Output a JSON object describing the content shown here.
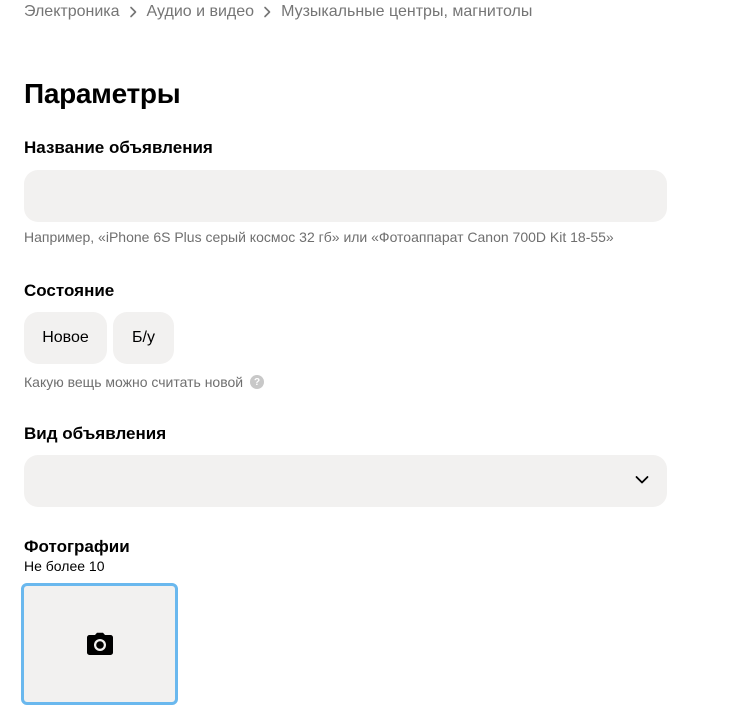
{
  "breadcrumb": {
    "items": [
      "Электроника",
      "Аудио и видео",
      "Музыкальные центры, магнитолы"
    ]
  },
  "page": {
    "title": "Параметры"
  },
  "title_field": {
    "label": "Название объявления",
    "value": "",
    "hint": "Например, «iPhone 6S Plus серый космос 32 гб» или «Фотоаппарат Canon 700D Kit 18-55»"
  },
  "condition": {
    "label": "Состояние",
    "options": [
      "Новое",
      "Б/у"
    ],
    "hint": "Какую вещь можно считать новой",
    "help_glyph": "?"
  },
  "ad_type": {
    "label": "Вид объявления",
    "value": ""
  },
  "photos": {
    "label": "Фотографии",
    "sublabel": "Не более 10"
  },
  "colors": {
    "field_bg": "#f2f1f0",
    "hint_text": "#6f6f6f",
    "photo_border": "#6ab8ee",
    "breadcrumb_text": "#757575"
  },
  "icons": [
    "chevron-right-icon",
    "chevron-down-icon",
    "camera-icon",
    "help-icon"
  ]
}
